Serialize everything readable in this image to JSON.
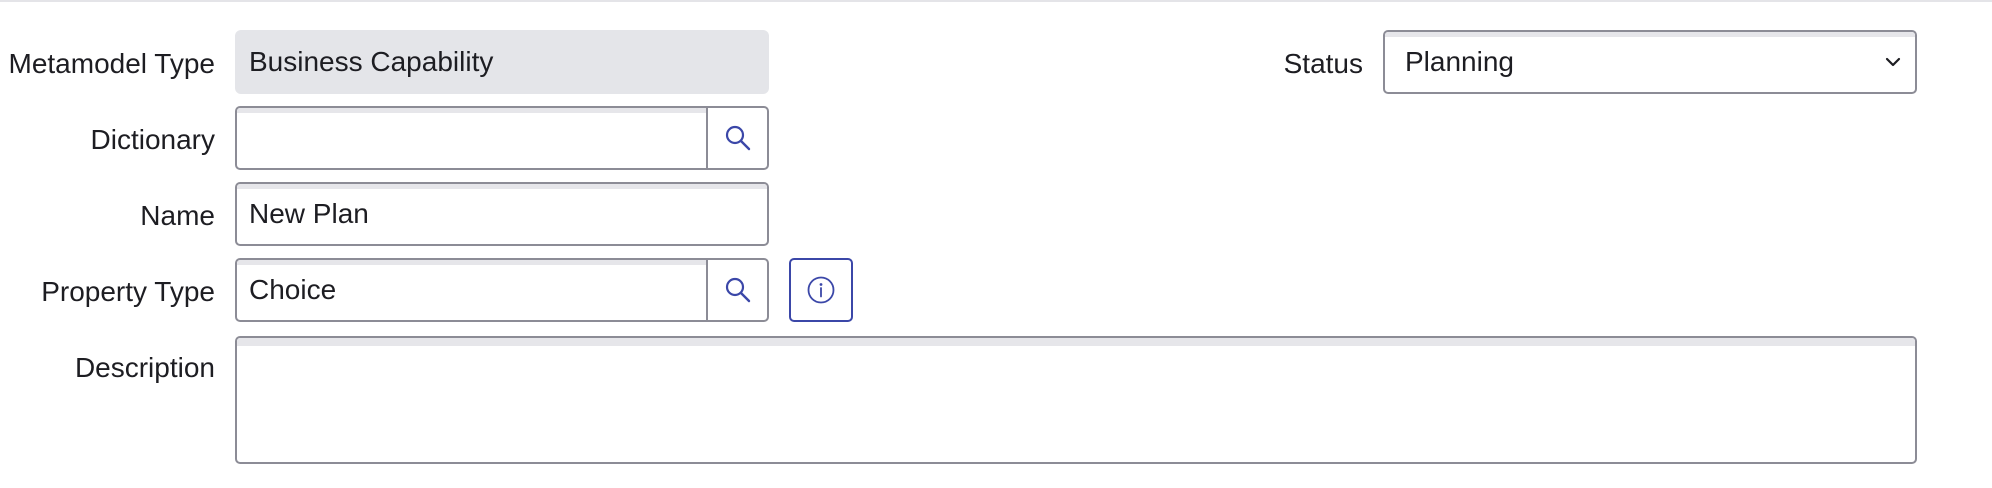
{
  "form": {
    "metamodel_type": {
      "label": "Metamodel Type",
      "value": "Business Capability"
    },
    "status": {
      "label": "Status",
      "selected": "Planning"
    },
    "dictionary": {
      "label": "Dictionary",
      "value": "",
      "button_icon": "search-icon"
    },
    "name": {
      "label": "Name",
      "value": "New Plan"
    },
    "property_type": {
      "label": "Property Type",
      "value": "Choice",
      "button_icon": "search-icon",
      "info_icon": "info-icon"
    },
    "description": {
      "label": "Description",
      "value": ""
    }
  },
  "colors": {
    "border": "#8c8c96",
    "readonly_bg": "#e4e5e9",
    "accent": "#3b47a8"
  }
}
